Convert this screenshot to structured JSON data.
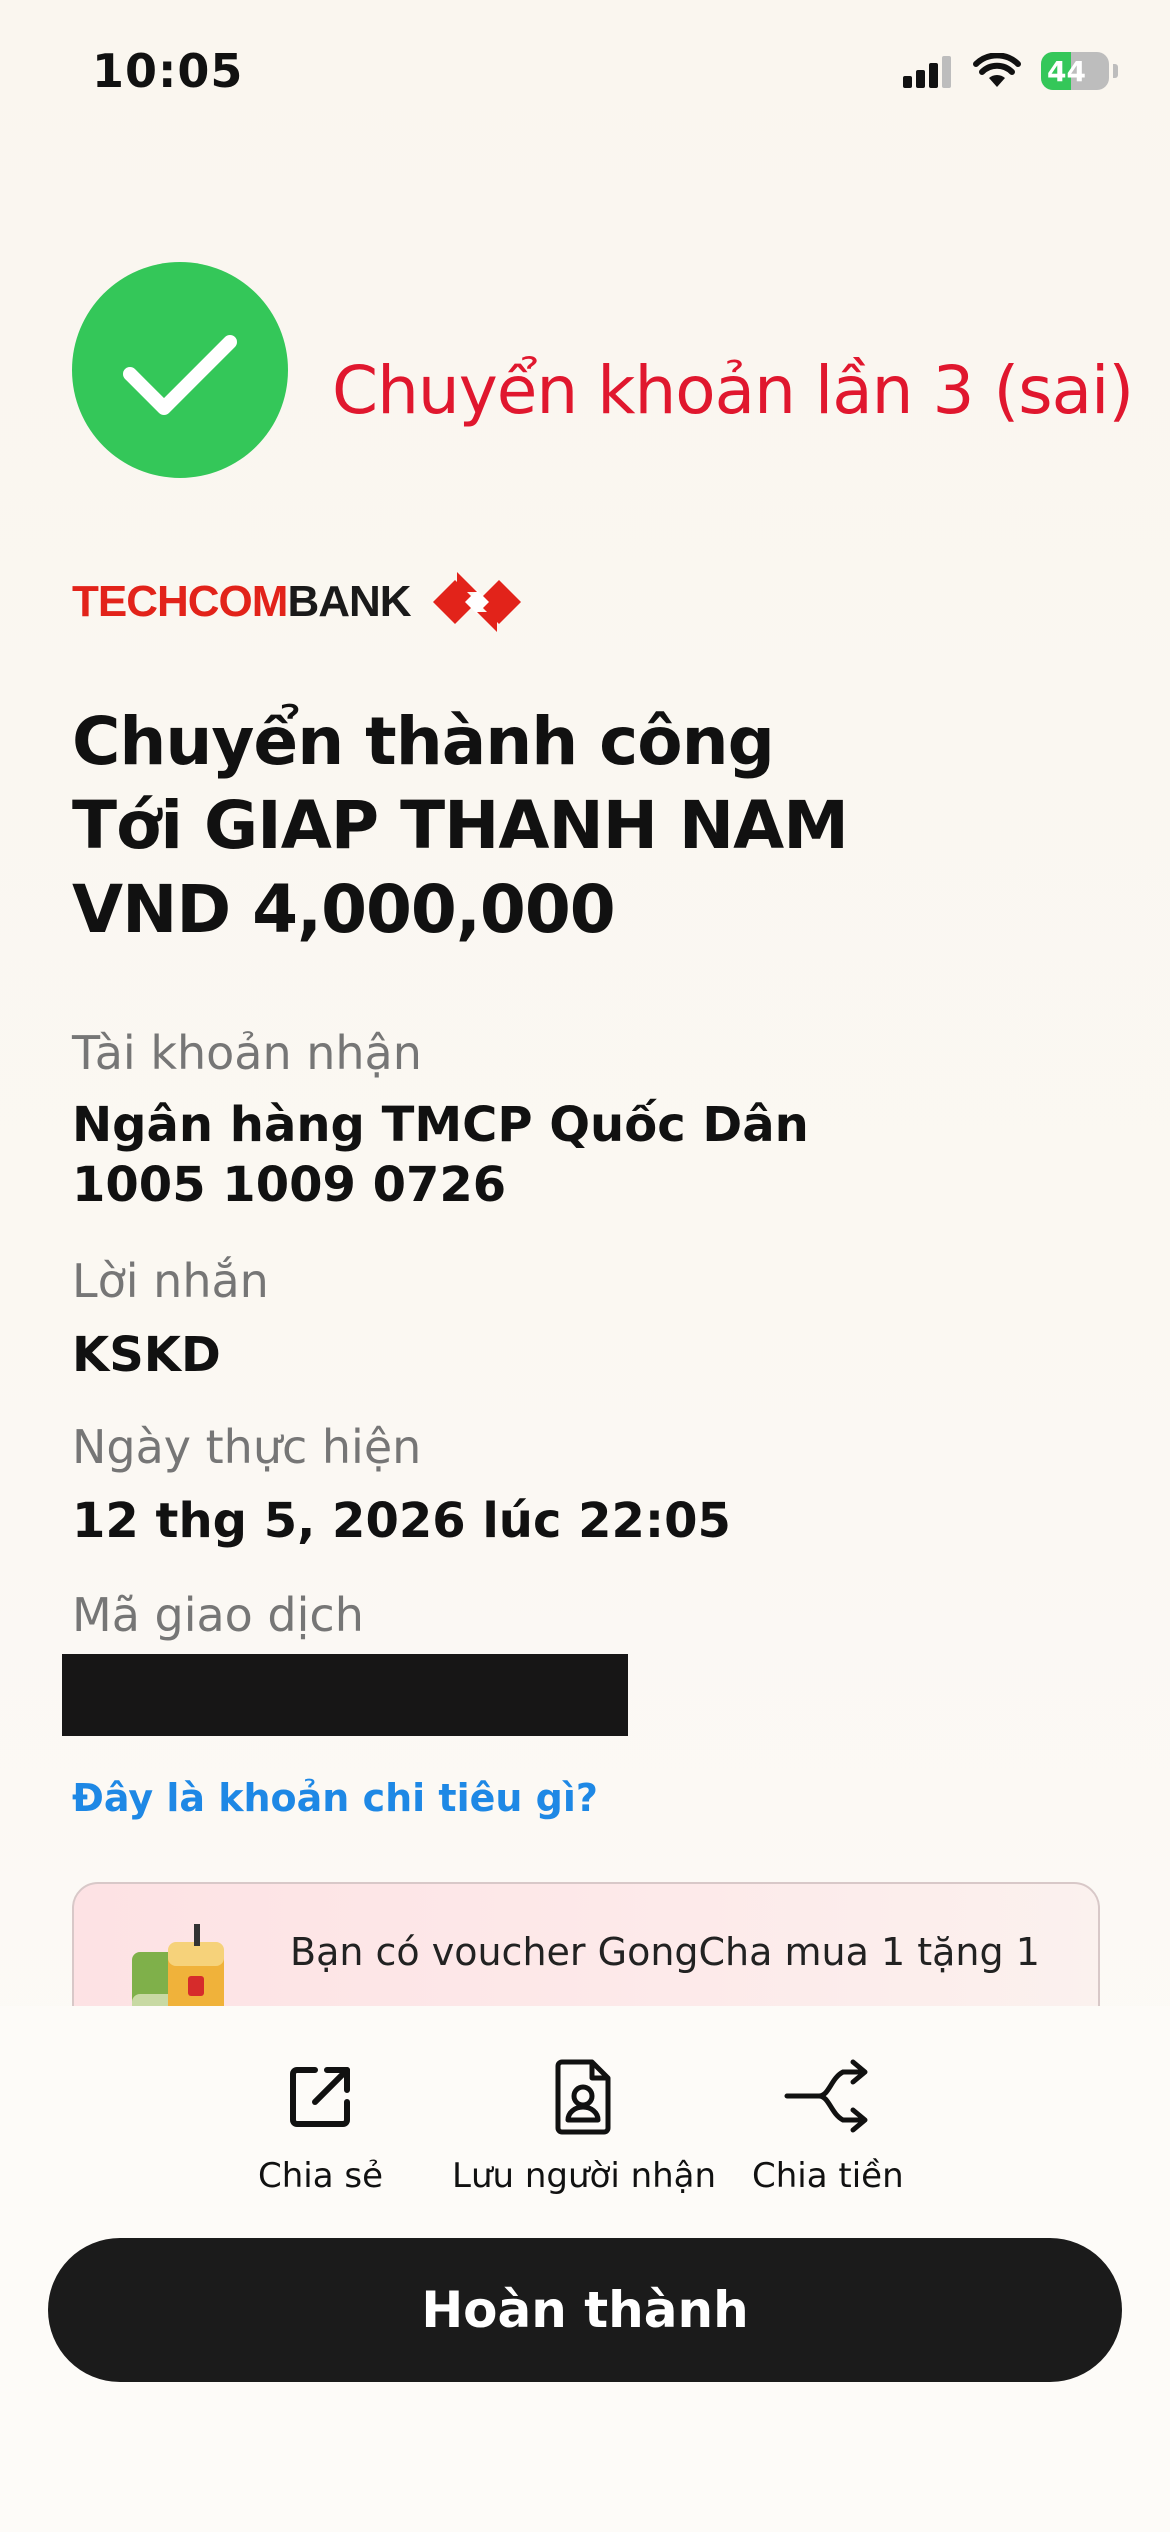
{
  "status_bar": {
    "time": "10:05",
    "battery": "44",
    "battery_level": 0.44
  },
  "annotation": "Chuyển khoản lần 3 (sai)",
  "logo": {
    "part1": "TECHCOM",
    "part2": "BANK"
  },
  "heading": {
    "line1": "Chuyển thành công",
    "line2": "Tới GIAP THANH NAM",
    "line3": "VND 4,000,000"
  },
  "details": {
    "receiver_label": "Tài khoản nhận",
    "bank_name": "Ngân hàng TMCP Quốc Dân",
    "account_number": "1005 1009 0726",
    "message_label": "Lời nhắn",
    "message": "KSKD",
    "date_label": "Ngày thực hiện",
    "date": "12 thg 5, 2026 lúc 22:05",
    "txn_label": "Mã giao dịch"
  },
  "spending_link": "Đây là khoản chi tiêu gì?",
  "voucher": {
    "text": "Bạn có voucher GongCha mua 1 tặng 1"
  },
  "actions": [
    {
      "label": "Chia sẻ",
      "icon": "share-icon"
    },
    {
      "label": "Lưu người nhận",
      "icon": "contact-save-icon"
    },
    {
      "label": "Chia tiền",
      "icon": "split-icon"
    }
  ],
  "done_button": "Hoàn thành",
  "colors": {
    "success": "#34c759",
    "annotation": "#e0172e",
    "brand_red": "#e2231a",
    "link": "#1e88e5",
    "button": "#1b1b1b"
  }
}
